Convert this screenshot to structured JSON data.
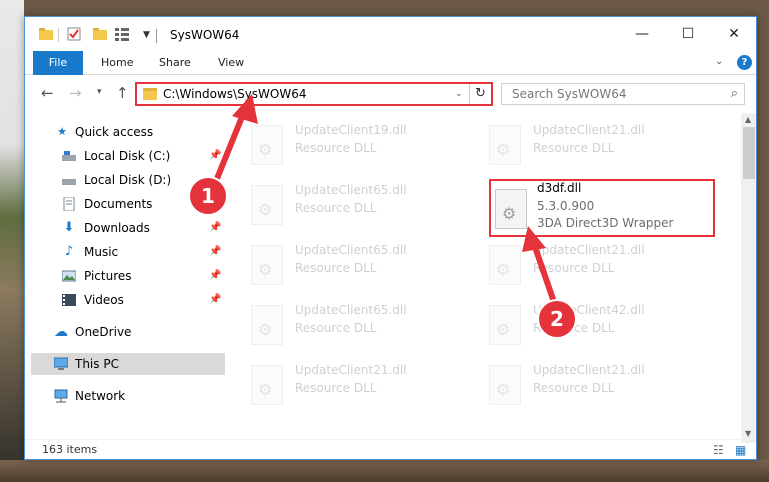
{
  "window": {
    "title": "SysWOW64",
    "min_label": "—",
    "max_label": "☐",
    "close_label": "✕"
  },
  "ribbon": {
    "file_tab": "File",
    "tabs": [
      "Home",
      "Share",
      "View"
    ],
    "help": "?"
  },
  "nav": {
    "address": "C:\\Windows\\SysWOW64",
    "search_placeholder": "Search SysWOW64"
  },
  "navpane": {
    "items": [
      {
        "label": "Quick access",
        "icon": "star-icon",
        "pinned": false
      },
      {
        "label": "Local Disk (C:)",
        "icon": "drive-icon",
        "pinned": true
      },
      {
        "label": "Local Disk (D:)",
        "icon": "drive-icon",
        "pinned": false
      },
      {
        "label": "Documents",
        "icon": "documents-icon",
        "pinned": true
      },
      {
        "label": "Downloads",
        "icon": "download-icon",
        "pinned": true
      },
      {
        "label": "Music",
        "icon": "music-icon",
        "pinned": true
      },
      {
        "label": "Pictures",
        "icon": "pictures-icon",
        "pinned": true
      },
      {
        "label": "Videos",
        "icon": "videos-icon",
        "pinned": true
      },
      {
        "label": "OneDrive",
        "icon": "cloud-icon",
        "pinned": false
      },
      {
        "label": "This PC",
        "icon": "computer-icon",
        "pinned": false
      },
      {
        "label": "Network",
        "icon": "network-icon",
        "pinned": false
      }
    ]
  },
  "files": {
    "faded": [
      {
        "name": "UpdateClient19.dll",
        "desc": "Resource DLL"
      },
      {
        "name": "UpdateClient21.dll",
        "desc": "Resource DLL"
      },
      {
        "name": "UpdateClient65.dll",
        "desc": "Resource DLL"
      },
      {
        "name": "UpdateClient65.dll",
        "desc": "Resource DLL"
      },
      {
        "name": "UpdateClient21.dll",
        "desc": "Resource DLL"
      },
      {
        "name": "UpdateClient65.dll",
        "desc": "Resource DLL"
      },
      {
        "name": "UpdateClient42.dll",
        "desc": "Resource DLL"
      },
      {
        "name": "UpdateClient21.dll",
        "desc": "Resource DLL"
      },
      {
        "name": "UpdateClient21.dll",
        "desc": "Resource DLL"
      }
    ],
    "highlighted": {
      "name": "d3df.dll",
      "version": "5.3.0.900",
      "desc": "3DA Direct3D Wrapper"
    }
  },
  "status": {
    "item_count": "163 items"
  },
  "callouts": [
    "1",
    "2"
  ],
  "colors": {
    "accent": "#1979ca",
    "highlight_red": "#e5333b",
    "selection": "#d9d9d9"
  }
}
